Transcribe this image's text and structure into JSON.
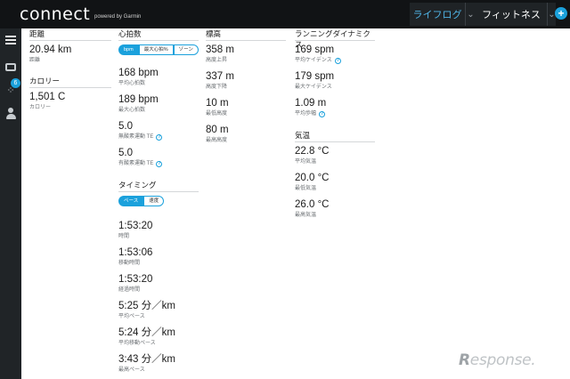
{
  "header": {
    "logo": "connect",
    "powered_by": "powered by Garmin",
    "tabs": [
      {
        "label": "ライフログ"
      },
      {
        "label": "フィットネス"
      }
    ],
    "caret": "⌄",
    "plus": "+"
  },
  "sidebar": {
    "badge": "6"
  },
  "distance": {
    "heading": "距離",
    "value": "20.94 km",
    "label": "距離"
  },
  "calories": {
    "heading": "カロリー",
    "value": "1,501 C",
    "label": "カロリー"
  },
  "heart": {
    "heading": "心拍数",
    "toggle": [
      "bpm",
      "最大心拍%",
      "ゾーン"
    ],
    "items": [
      {
        "value": "168 bpm",
        "label": "平均心拍数"
      },
      {
        "value": "189 bpm",
        "label": "最大心拍数"
      },
      {
        "value": "5.0",
        "label": "無酸素運動 TE"
      },
      {
        "value": "5.0",
        "label": "有酸素運動 TE"
      }
    ]
  },
  "timing": {
    "heading": "タイミング",
    "toggle": [
      "ペース",
      "速度"
    ],
    "items": [
      {
        "value": "1:53:20",
        "label": "時間"
      },
      {
        "value": "1:53:06",
        "label": "移動時間"
      },
      {
        "value": "1:53:20",
        "label": "経過時間"
      },
      {
        "value": "5:25 分／km",
        "label": "平均ペース"
      },
      {
        "value": "5:24 分／km",
        "label": "平均移動ペース"
      },
      {
        "value": "3:43 分／km",
        "label": "最高ペース"
      }
    ]
  },
  "elevation": {
    "heading": "標高",
    "items": [
      {
        "value": "358 m",
        "label": "高度上昇"
      },
      {
        "value": "337 m",
        "label": "高度下降"
      },
      {
        "value": "10 m",
        "label": "最低高度"
      },
      {
        "value": "80 m",
        "label": "最高高度"
      }
    ]
  },
  "running": {
    "heading": "ランニングダイナミクス",
    "items": [
      {
        "value": "169 spm",
        "label": "平均ケイデンス"
      },
      {
        "value": "179 spm",
        "label": "最大ケイデンス"
      },
      {
        "value": "1.09 m",
        "label": "平均歩幅"
      }
    ]
  },
  "temperature": {
    "heading": "気温",
    "items": [
      {
        "value": "22.8 °C",
        "label": "平均気温"
      },
      {
        "value": "20.0 °C",
        "label": "最低気温"
      },
      {
        "value": "26.0 °C",
        "label": "最高気温"
      }
    ]
  },
  "watermark": {
    "letter": "R",
    "text": "esponse."
  },
  "colors": {
    "accent": "#1ba1dc",
    "header_bg": "#111315",
    "sidebar_bg": "#202427"
  }
}
